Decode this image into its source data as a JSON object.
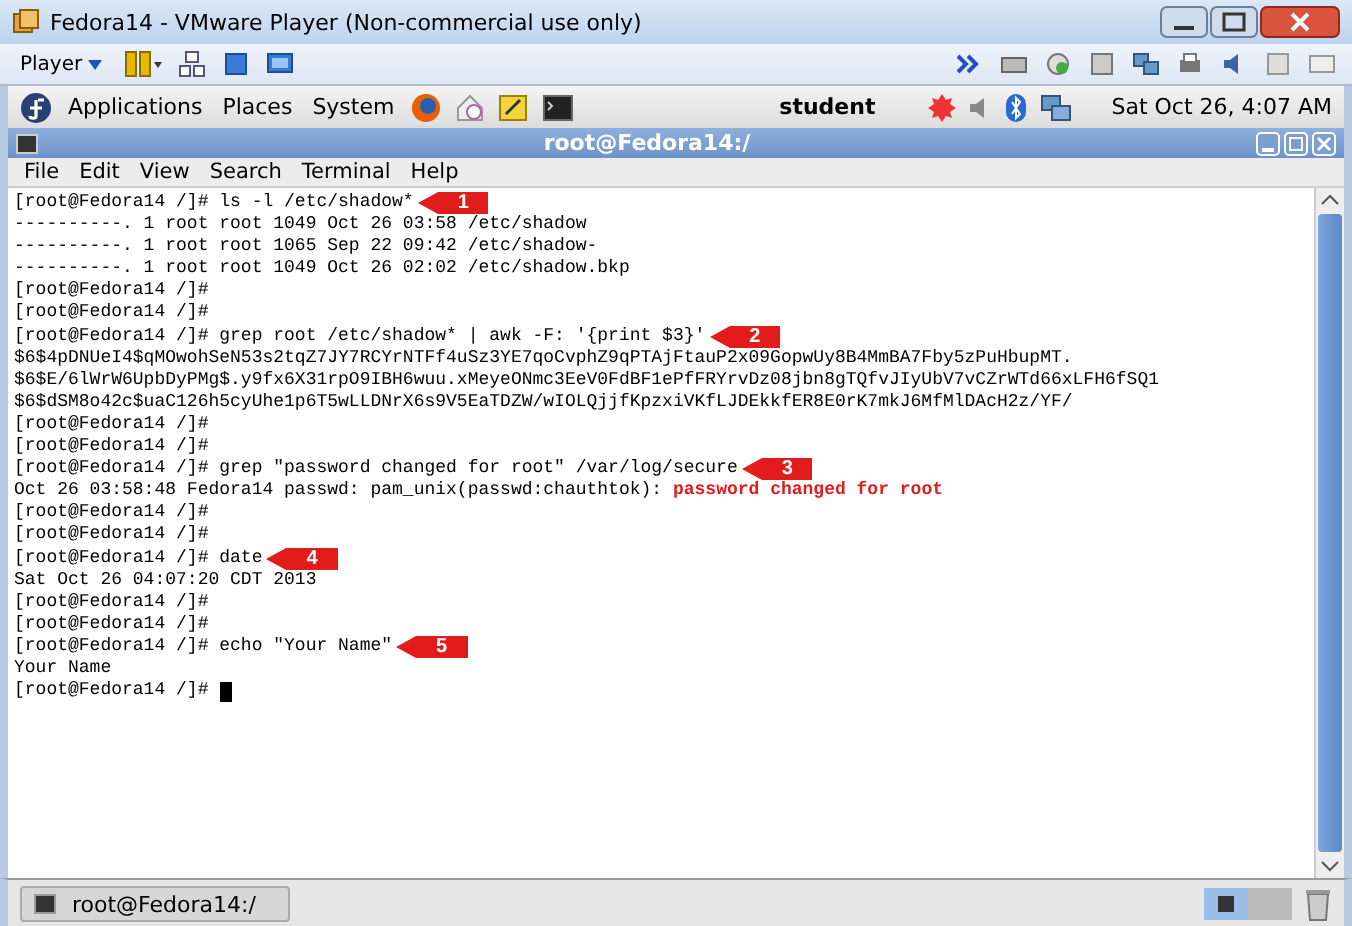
{
  "vm_window": {
    "title": "Fedora14 - VMware Player (Non-commercial use only)"
  },
  "vm_toolbar": {
    "player_menu": "Player"
  },
  "gnome_panel": {
    "menus": [
      "Applications",
      "Places",
      "System"
    ],
    "user": "student",
    "clock": "Sat Oct 26,  4:07 AM"
  },
  "terminal": {
    "title": "root@Fedora14:/",
    "menus": [
      "File",
      "Edit",
      "View",
      "Search",
      "Terminal",
      "Help"
    ],
    "lines": [
      {
        "segments": [
          {
            "kind": "normal",
            "text": "[root@Fedora14 /]# ls -l /etc/shadow*"
          }
        ],
        "arrow": "1"
      },
      {
        "segments": [
          {
            "kind": "normal",
            "text": "----------. 1 root root 1049 Oct 26 03:58 /etc/shadow"
          }
        ]
      },
      {
        "segments": [
          {
            "kind": "normal",
            "text": "----------. 1 root root 1065 Sep 22 09:42 /etc/shadow-"
          }
        ]
      },
      {
        "segments": [
          {
            "kind": "normal",
            "text": "----------. 1 root root 1049 Oct 26 02:02 /etc/shadow.bkp"
          }
        ]
      },
      {
        "segments": [
          {
            "kind": "normal",
            "text": "[root@Fedora14 /]#"
          }
        ]
      },
      {
        "segments": [
          {
            "kind": "normal",
            "text": "[root@Fedora14 /]#"
          }
        ]
      },
      {
        "segments": [
          {
            "kind": "normal",
            "text": "[root@Fedora14 /]# grep root /etc/shadow* | awk -F: '{print $3}'"
          }
        ],
        "arrow": "2"
      },
      {
        "segments": [
          {
            "kind": "normal",
            "text": "$6$4pDNUeI4$qMOwohSeN53s2tqZ7JY7RCYrNTFf4uSz3YE7qoCvphZ9qPTAjFtauP2x09GopwUy8B4MmBA7Fby5zPuHbupMT."
          }
        ]
      },
      {
        "segments": [
          {
            "kind": "normal",
            "text": "$6$E/6lWrW6UpbDyPMg$.y9fx6X31rpO9IBH6wuu.xMeyeONmc3EeV0FdBF1ePfFRYrvDz08jbn8gTQfvJIyUbV7vCZrWTd66xLFH6fSQ1"
          }
        ]
      },
      {
        "segments": [
          {
            "kind": "normal",
            "text": "$6$dSM8o42c$uaC126h5cyUhe1p6T5wLLDNrX6s9V5EaTDZW/wIOLQjjfKpzxiVKfLJDEkkfER8E0rK7mkJ6MfMlDAcH2z/YF/"
          }
        ]
      },
      {
        "segments": [
          {
            "kind": "normal",
            "text": "[root@Fedora14 /]#"
          }
        ]
      },
      {
        "segments": [
          {
            "kind": "normal",
            "text": "[root@Fedora14 /]#"
          }
        ]
      },
      {
        "segments": [
          {
            "kind": "normal",
            "text": "[root@Fedora14 /]# grep \"password changed for root\" /var/log/secure"
          }
        ],
        "arrow": "3"
      },
      {
        "segments": [
          {
            "kind": "normal",
            "text": "Oct 26 03:58:48 Fedora14 passwd: pam_unix(passwd:chauthtok): "
          },
          {
            "kind": "match",
            "text": "password changed for root"
          }
        ]
      },
      {
        "segments": [
          {
            "kind": "normal",
            "text": "[root@Fedora14 /]#"
          }
        ]
      },
      {
        "segments": [
          {
            "kind": "normal",
            "text": "[root@Fedora14 /]#"
          }
        ]
      },
      {
        "segments": [
          {
            "kind": "normal",
            "text": "[root@Fedora14 /]# date"
          }
        ],
        "arrow": "4"
      },
      {
        "segments": [
          {
            "kind": "normal",
            "text": "Sat Oct 26 04:07:20 CDT 2013"
          }
        ]
      },
      {
        "segments": [
          {
            "kind": "normal",
            "text": "[root@Fedora14 /]#"
          }
        ]
      },
      {
        "segments": [
          {
            "kind": "normal",
            "text": "[root@Fedora14 /]#"
          }
        ]
      },
      {
        "segments": [
          {
            "kind": "normal",
            "text": "[root@Fedora14 /]# echo \"Your Name\""
          }
        ],
        "arrow": "5"
      },
      {
        "segments": [
          {
            "kind": "normal",
            "text": "Your Name"
          }
        ]
      },
      {
        "segments": [
          {
            "kind": "normal",
            "text": "[root@Fedora14 /]# "
          },
          {
            "kind": "cursor"
          }
        ]
      }
    ]
  },
  "bottom_panel": {
    "task": "root@Fedora14:/"
  }
}
